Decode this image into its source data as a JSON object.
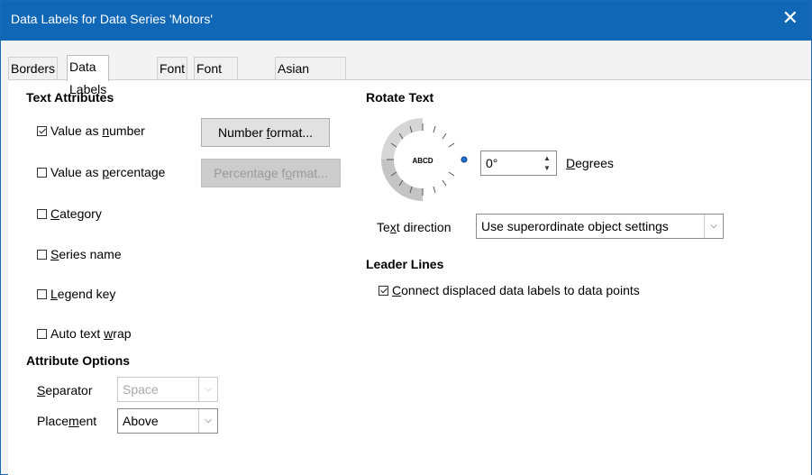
{
  "window": {
    "title": "Data Labels for Data Series 'Motors'",
    "close_glyph": "✕"
  },
  "tabs": [
    "Borders",
    "Data Labels",
    "Font",
    "Font Effects",
    "Asian Typography"
  ],
  "active_tab": "Data Labels",
  "text_attributes": {
    "heading": "Text Attributes",
    "value_as_number": {
      "pre": "Value as ",
      "mn": "n",
      "post": "umber",
      "checked": true
    },
    "value_as_percentage": {
      "pre": "Value as ",
      "mn": "p",
      "post": "ercentage",
      "checked": false
    },
    "category": {
      "pre": "",
      "mn": "C",
      "post": "ategory",
      "checked": false
    },
    "series_name": {
      "pre": "",
      "mn": "S",
      "post": "eries name",
      "checked": false
    },
    "legend_key": {
      "pre": "",
      "mn": "L",
      "post": "egend key",
      "checked": false
    },
    "auto_text_wrap": {
      "pre": "Auto text ",
      "mn": "w",
      "post": "rap",
      "checked": false
    },
    "number_format_button": {
      "pre": "Number ",
      "mn": "f",
      "post": "ormat..."
    },
    "percentage_format_button": {
      "pre": "Percentage f",
      "mn": "o",
      "post": "rmat..."
    }
  },
  "attribute_options": {
    "heading": "Attribute Options",
    "separator_label": {
      "pre": "",
      "mn": "S",
      "post": "eparator"
    },
    "separator_value": "Space",
    "placement_label": {
      "pre": "Place",
      "mn": "m",
      "post": "ent"
    },
    "placement_value": "Above"
  },
  "rotate_text": {
    "heading": "Rotate Text",
    "dial_text": "ABCD",
    "degrees_value": "0°",
    "degrees_label": {
      "pre": "",
      "mn": "D",
      "post": "egrees"
    },
    "text_direction_label": {
      "pre": "Te",
      "mn": "x",
      "post": "t direction"
    },
    "text_direction_value": "Use superordinate object settings"
  },
  "leader_lines": {
    "heading": "Leader Lines",
    "connect": {
      "pre": "",
      "mn": "C",
      "post": "onnect displaced data labels to data points",
      "checked": true
    }
  },
  "colors": {
    "titlebar": "#0f67b6",
    "dial_knob": "#1f6fd1"
  }
}
